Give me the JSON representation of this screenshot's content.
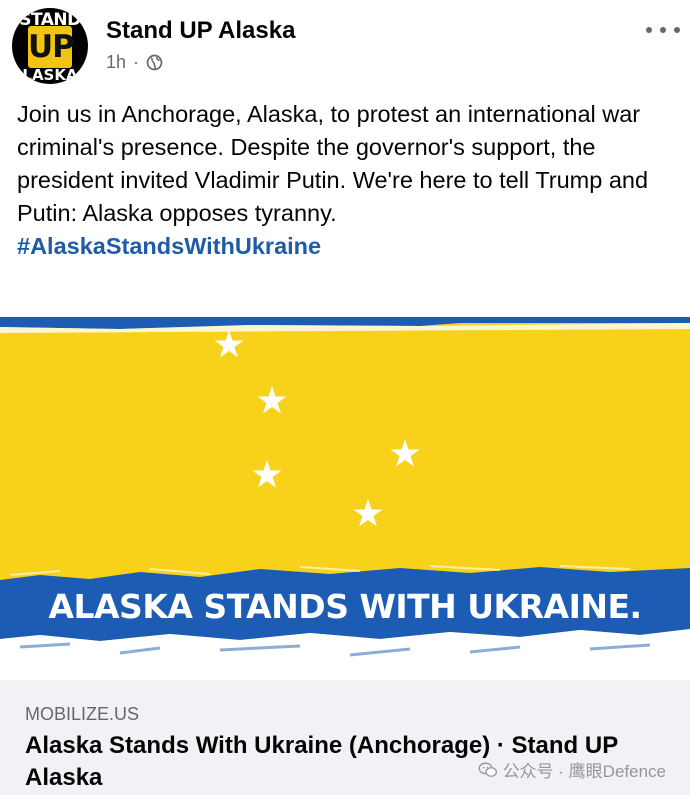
{
  "post": {
    "page_name": "Stand UP Alaska",
    "timestamp": "1h",
    "separator": "·",
    "audience_icon": "globe-icon",
    "more_icon": "more-options-icon",
    "text": "Join us in Anchorage, Alaska, to protest an international war criminal's presence. Despite the governor's support, the president invited Vladimir Putin. We're here to tell Trump and Putin: Alaska opposes tyranny.",
    "hashtag": "#AlaskaStandsWithUkraine"
  },
  "avatar": {
    "top_text": "STAND",
    "middle_text": "UP",
    "bottom_text": "LASKA"
  },
  "banner": {
    "text": "ALASKA STANDS WITH UKRAINE.",
    "colors": {
      "yellow": "#f8d21a",
      "blue": "#1d5cb5",
      "white": "#ffffff"
    }
  },
  "link_preview": {
    "domain": "MOBILIZE.US",
    "title": "Alaska Stands With Ukraine (Anchorage) · Stand UP Alaska"
  },
  "watermark": {
    "icon": "wechat-icon",
    "text": "公众号 · 鹰眼Defence"
  }
}
